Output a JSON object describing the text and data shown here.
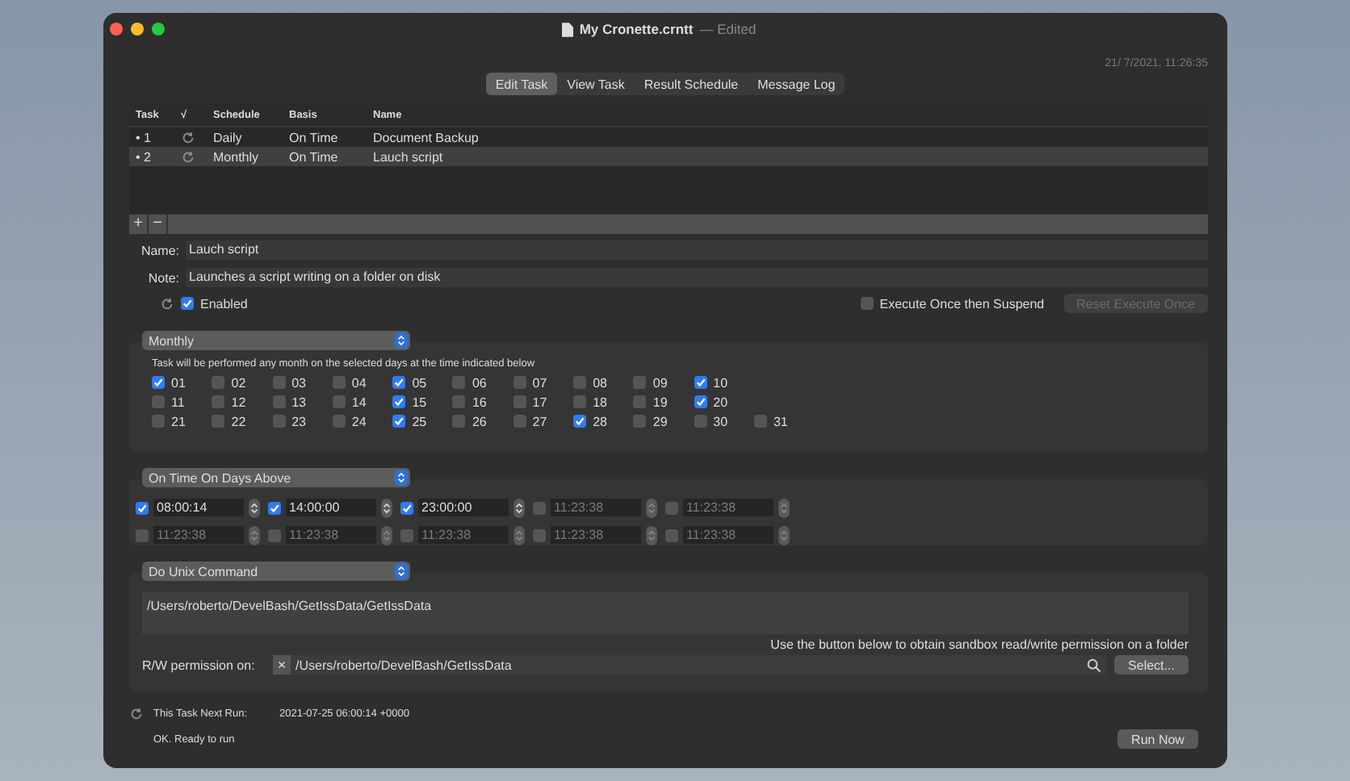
{
  "window": {
    "title": "My Cronette.crntt",
    "status": "— Edited",
    "clock": "21/ 7/2021, 11:26:35"
  },
  "tabs": [
    {
      "label": "Edit Task",
      "selected": true
    },
    {
      "label": "View Task",
      "selected": false
    },
    {
      "label": "Result Schedule",
      "selected": false
    },
    {
      "label": "Message Log",
      "selected": false
    }
  ],
  "table": {
    "columns": [
      "Task",
      "√",
      "Schedule",
      "Basis",
      "Name"
    ],
    "rows": [
      {
        "task": "• 1",
        "schedule": "Daily",
        "basis": "On Time",
        "name": "Document Backup",
        "selected": false
      },
      {
        "task": "• 2",
        "schedule": "Monthly",
        "basis": "On Time",
        "name": "Lauch script",
        "selected": true
      }
    ]
  },
  "list_buttons": [
    "+",
    "−"
  ],
  "name_field": {
    "label": "Name:",
    "value": "Lauch script"
  },
  "note_field": {
    "label": "Note:",
    "value": "Launches a script writing on a folder on disk"
  },
  "enabled": {
    "label": "Enabled",
    "checked": true
  },
  "execute_once": {
    "label": "Execute Once then Suspend",
    "checked": false
  },
  "reset_button": {
    "label": "Reset Execute Once",
    "disabled": true
  },
  "schedule_popup": "Monthly",
  "schedule_hint": "Task will be performed any month on the selected days at the time indicated below",
  "day_rows": [
    [
      {
        "label": "01",
        "checked": true
      },
      {
        "label": "02",
        "checked": false
      },
      {
        "label": "03",
        "checked": false
      },
      {
        "label": "04",
        "checked": false
      },
      {
        "label": "05",
        "checked": true
      },
      {
        "label": "06",
        "checked": false
      },
      {
        "label": "07",
        "checked": false
      },
      {
        "label": "08",
        "checked": false
      },
      {
        "label": "09",
        "checked": false
      },
      {
        "label": "10",
        "checked": true
      }
    ],
    [
      {
        "label": "11",
        "checked": false
      },
      {
        "label": "12",
        "checked": false
      },
      {
        "label": "13",
        "checked": false
      },
      {
        "label": "14",
        "checked": false
      },
      {
        "label": "15",
        "checked": true
      },
      {
        "label": "16",
        "checked": false
      },
      {
        "label": "17",
        "checked": false
      },
      {
        "label": "18",
        "checked": false
      },
      {
        "label": "19",
        "checked": false
      },
      {
        "label": "20",
        "checked": true
      }
    ],
    [
      {
        "label": "21",
        "checked": false
      },
      {
        "label": "22",
        "checked": false
      },
      {
        "label": "23",
        "checked": false
      },
      {
        "label": "24",
        "checked": false
      },
      {
        "label": "25",
        "checked": true
      },
      {
        "label": "26",
        "checked": false
      },
      {
        "label": "27",
        "checked": false
      },
      {
        "label": "28",
        "checked": true
      },
      {
        "label": "29",
        "checked": false
      },
      {
        "label": "30",
        "checked": false
      },
      {
        "label": "31",
        "checked": false
      }
    ]
  ],
  "time_popup": "On Time On Days Above",
  "time_rows": [
    [
      {
        "value": "08:00:14",
        "checked": true
      },
      {
        "value": "14:00:00",
        "checked": true
      },
      {
        "value": "23:00:00",
        "checked": true
      },
      {
        "value": "11:23:38",
        "checked": false
      },
      {
        "value": "11:23:38",
        "checked": false
      }
    ],
    [
      {
        "value": "11:23:38",
        "checked": false
      },
      {
        "value": "11:23:38",
        "checked": false
      },
      {
        "value": "11:23:38",
        "checked": false
      },
      {
        "value": "11:23:38",
        "checked": false
      },
      {
        "value": "11:23:38",
        "checked": false
      }
    ]
  ],
  "action_popup": "Do Unix Command",
  "command": "/Users/roberto/DevelBash/GetIssData/GetIssData",
  "permission_hint": "Use the button below to obtain sandbox read/write permission on a folder",
  "permission": {
    "label": "R/W permission on:",
    "clear": "×",
    "path": "/Users/roberto/DevelBash/GetIssData",
    "button": "Select..."
  },
  "next_run": {
    "label": "This Task Next Run:",
    "value": "2021-07-25 06:00:14 +0000"
  },
  "status": "OK. Ready to run",
  "run_button": "Run Now"
}
